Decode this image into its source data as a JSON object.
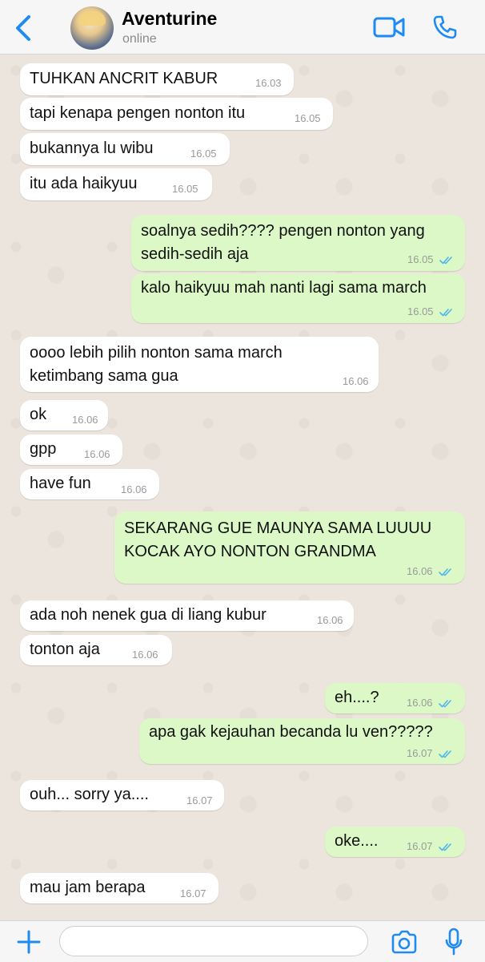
{
  "header": {
    "contact_name": "Aventurine",
    "status": "online"
  },
  "colors": {
    "accent": "#1E8BF3",
    "incoming_bubble": "#FFFFFF",
    "outgoing_bubble": "#DCF8C6",
    "chat_background": "#ECE5DD",
    "read_ticks": "#4FB6EC"
  },
  "icons": {
    "back": "chevron-left-icon",
    "video": "video-camera-icon",
    "call": "phone-icon",
    "attach": "plus-icon",
    "sticker": "sticker-icon",
    "camera": "camera-icon",
    "mic": "microphone-icon"
  },
  "messages": [
    {
      "dir": "in",
      "text": "TUHKAN ANCRIT KABUR",
      "time": "16.03"
    },
    {
      "dir": "in",
      "text": "tapi kenapa pengen nonton itu",
      "time": "16.05"
    },
    {
      "dir": "in",
      "text": "bukannya lu wibu",
      "time": "16.05"
    },
    {
      "dir": "in",
      "text": "itu ada haikyuu",
      "time": "16.05"
    },
    {
      "dir": "out",
      "text": "soalnya sedih???? pengen nonton yang\nsedih-sedih aja",
      "time": "16.05",
      "read": true
    },
    {
      "dir": "out",
      "text": "kalo haikyuu mah nanti lagi sama march",
      "time": "16.05",
      "read": true
    },
    {
      "dir": "in",
      "text": "oooo lebih pilih nonton sama march\nketimbang sama gua",
      "time": "16.06"
    },
    {
      "dir": "in",
      "text": "ok",
      "time": "16.06"
    },
    {
      "dir": "in",
      "text": "gpp",
      "time": "16.06"
    },
    {
      "dir": "in",
      "text": "have fun",
      "time": "16.06"
    },
    {
      "dir": "out",
      "text": "SEKARANG GUE MAUNYA SAMA LUUUU\nKOCAK AYO NONTON GRANDMA",
      "time": "16.06",
      "read": true
    },
    {
      "dir": "in",
      "text": "ada noh nenek gua di liang kubur",
      "time": "16.06"
    },
    {
      "dir": "in",
      "text": "tonton aja",
      "time": "16.06"
    },
    {
      "dir": "out",
      "text": "eh....?",
      "time": "16.06",
      "read": true
    },
    {
      "dir": "out",
      "text": "apa gak kejauhan becanda lu ven?????",
      "time": "16.07",
      "read": true
    },
    {
      "dir": "in",
      "text": "ouh... sorry ya....",
      "time": "16.07"
    },
    {
      "dir": "out",
      "text": "oke....",
      "time": "16.07",
      "read": true
    },
    {
      "dir": "in",
      "text": "mau jam berapa",
      "time": "16.07"
    }
  ],
  "composer": {
    "value": ""
  }
}
